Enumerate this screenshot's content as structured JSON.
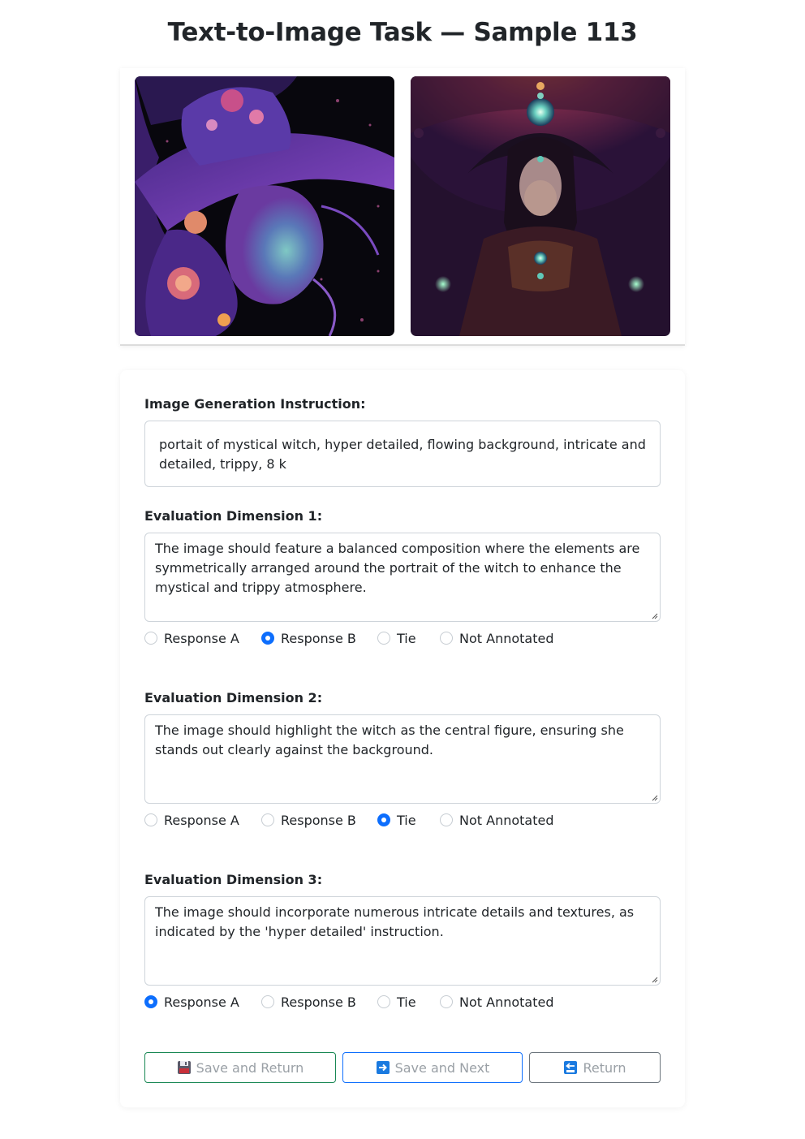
{
  "page": {
    "title": "Text-to-Image Task — Sample 113"
  },
  "images": [
    {
      "icon": "witch-portrait-image-a"
    },
    {
      "icon": "witch-portrait-image-b"
    }
  ],
  "instruction": {
    "label": "Image Generation Instruction:",
    "text": "portait of mystical witch, hyper detailed, flowing background, intricate and detailed, trippy, 8 k"
  },
  "radio_options": [
    "Response A",
    "Response B",
    "Tie",
    "Not Annotated"
  ],
  "dimensions": [
    {
      "label": "Evaluation Dimension 1:",
      "text": "The image should feature a balanced composition where the elements are symmetrically arranged around the portrait of the witch to enhance the mystical and trippy atmosphere.",
      "selected": "Response B"
    },
    {
      "label": "Evaluation Dimension 2:",
      "text": "The image should highlight the witch as the central figure, ensuring she stands out clearly against the background.",
      "selected": "Tie"
    },
    {
      "label": "Evaluation Dimension 3:",
      "text": "The image should incorporate numerous intricate details and textures, as indicated by the 'hyper detailed' instruction.",
      "selected": "Response A"
    }
  ],
  "buttons": {
    "save_return": "Save and Return",
    "save_next": "Save and Next",
    "return": "Return"
  },
  "colors": {
    "primary": "#0d6efd",
    "success": "#198754",
    "secondary": "#6c757d"
  }
}
